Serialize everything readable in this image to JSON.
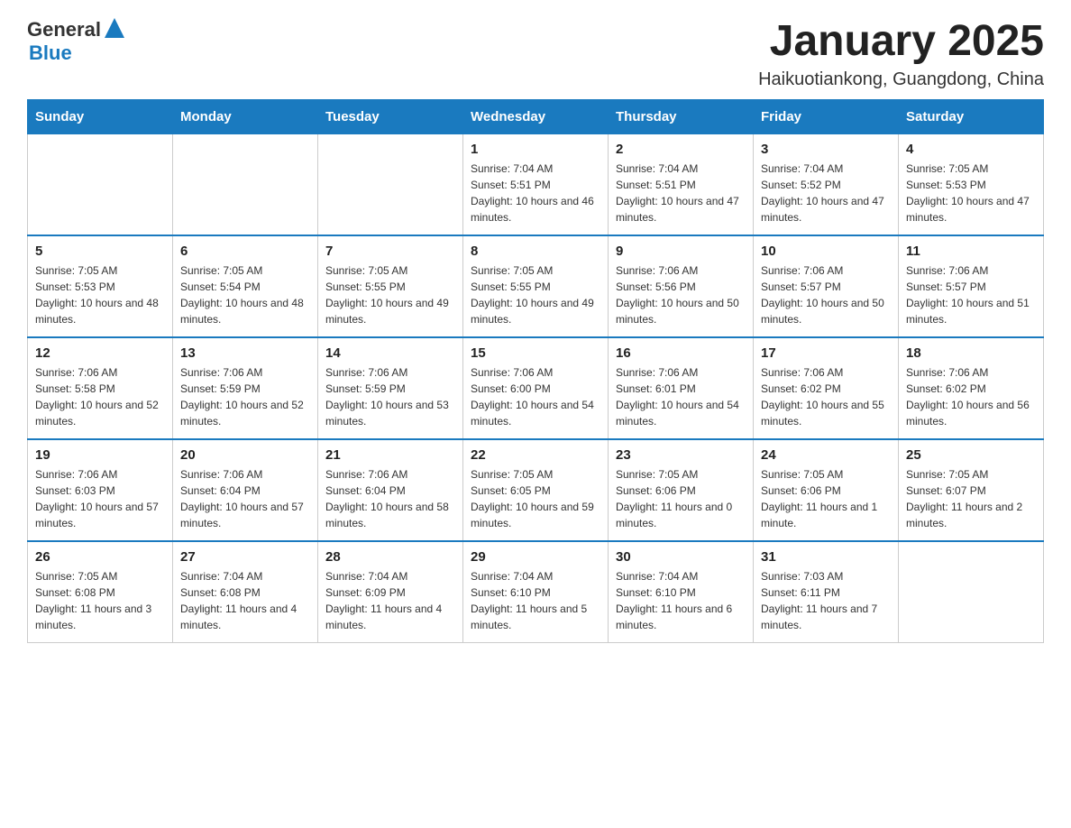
{
  "header": {
    "logo": {
      "general": "General",
      "blue": "Blue"
    },
    "title": "January 2025",
    "subtitle": "Haikuotiankong, Guangdong, China"
  },
  "days_of_week": [
    "Sunday",
    "Monday",
    "Tuesday",
    "Wednesday",
    "Thursday",
    "Friday",
    "Saturday"
  ],
  "weeks": [
    {
      "days": [
        {
          "num": "",
          "info": ""
        },
        {
          "num": "",
          "info": ""
        },
        {
          "num": "",
          "info": ""
        },
        {
          "num": "1",
          "info": "Sunrise: 7:04 AM\nSunset: 5:51 PM\nDaylight: 10 hours and 46 minutes."
        },
        {
          "num": "2",
          "info": "Sunrise: 7:04 AM\nSunset: 5:51 PM\nDaylight: 10 hours and 47 minutes."
        },
        {
          "num": "3",
          "info": "Sunrise: 7:04 AM\nSunset: 5:52 PM\nDaylight: 10 hours and 47 minutes."
        },
        {
          "num": "4",
          "info": "Sunrise: 7:05 AM\nSunset: 5:53 PM\nDaylight: 10 hours and 47 minutes."
        }
      ]
    },
    {
      "days": [
        {
          "num": "5",
          "info": "Sunrise: 7:05 AM\nSunset: 5:53 PM\nDaylight: 10 hours and 48 minutes."
        },
        {
          "num": "6",
          "info": "Sunrise: 7:05 AM\nSunset: 5:54 PM\nDaylight: 10 hours and 48 minutes."
        },
        {
          "num": "7",
          "info": "Sunrise: 7:05 AM\nSunset: 5:55 PM\nDaylight: 10 hours and 49 minutes."
        },
        {
          "num": "8",
          "info": "Sunrise: 7:05 AM\nSunset: 5:55 PM\nDaylight: 10 hours and 49 minutes."
        },
        {
          "num": "9",
          "info": "Sunrise: 7:06 AM\nSunset: 5:56 PM\nDaylight: 10 hours and 50 minutes."
        },
        {
          "num": "10",
          "info": "Sunrise: 7:06 AM\nSunset: 5:57 PM\nDaylight: 10 hours and 50 minutes."
        },
        {
          "num": "11",
          "info": "Sunrise: 7:06 AM\nSunset: 5:57 PM\nDaylight: 10 hours and 51 minutes."
        }
      ]
    },
    {
      "days": [
        {
          "num": "12",
          "info": "Sunrise: 7:06 AM\nSunset: 5:58 PM\nDaylight: 10 hours and 52 minutes."
        },
        {
          "num": "13",
          "info": "Sunrise: 7:06 AM\nSunset: 5:59 PM\nDaylight: 10 hours and 52 minutes."
        },
        {
          "num": "14",
          "info": "Sunrise: 7:06 AM\nSunset: 5:59 PM\nDaylight: 10 hours and 53 minutes."
        },
        {
          "num": "15",
          "info": "Sunrise: 7:06 AM\nSunset: 6:00 PM\nDaylight: 10 hours and 54 minutes."
        },
        {
          "num": "16",
          "info": "Sunrise: 7:06 AM\nSunset: 6:01 PM\nDaylight: 10 hours and 54 minutes."
        },
        {
          "num": "17",
          "info": "Sunrise: 7:06 AM\nSunset: 6:02 PM\nDaylight: 10 hours and 55 minutes."
        },
        {
          "num": "18",
          "info": "Sunrise: 7:06 AM\nSunset: 6:02 PM\nDaylight: 10 hours and 56 minutes."
        }
      ]
    },
    {
      "days": [
        {
          "num": "19",
          "info": "Sunrise: 7:06 AM\nSunset: 6:03 PM\nDaylight: 10 hours and 57 minutes."
        },
        {
          "num": "20",
          "info": "Sunrise: 7:06 AM\nSunset: 6:04 PM\nDaylight: 10 hours and 57 minutes."
        },
        {
          "num": "21",
          "info": "Sunrise: 7:06 AM\nSunset: 6:04 PM\nDaylight: 10 hours and 58 minutes."
        },
        {
          "num": "22",
          "info": "Sunrise: 7:05 AM\nSunset: 6:05 PM\nDaylight: 10 hours and 59 minutes."
        },
        {
          "num": "23",
          "info": "Sunrise: 7:05 AM\nSunset: 6:06 PM\nDaylight: 11 hours and 0 minutes."
        },
        {
          "num": "24",
          "info": "Sunrise: 7:05 AM\nSunset: 6:06 PM\nDaylight: 11 hours and 1 minute."
        },
        {
          "num": "25",
          "info": "Sunrise: 7:05 AM\nSunset: 6:07 PM\nDaylight: 11 hours and 2 minutes."
        }
      ]
    },
    {
      "days": [
        {
          "num": "26",
          "info": "Sunrise: 7:05 AM\nSunset: 6:08 PM\nDaylight: 11 hours and 3 minutes."
        },
        {
          "num": "27",
          "info": "Sunrise: 7:04 AM\nSunset: 6:08 PM\nDaylight: 11 hours and 4 minutes."
        },
        {
          "num": "28",
          "info": "Sunrise: 7:04 AM\nSunset: 6:09 PM\nDaylight: 11 hours and 4 minutes."
        },
        {
          "num": "29",
          "info": "Sunrise: 7:04 AM\nSunset: 6:10 PM\nDaylight: 11 hours and 5 minutes."
        },
        {
          "num": "30",
          "info": "Sunrise: 7:04 AM\nSunset: 6:10 PM\nDaylight: 11 hours and 6 minutes."
        },
        {
          "num": "31",
          "info": "Sunrise: 7:03 AM\nSunset: 6:11 PM\nDaylight: 11 hours and 7 minutes."
        },
        {
          "num": "",
          "info": ""
        }
      ]
    }
  ]
}
